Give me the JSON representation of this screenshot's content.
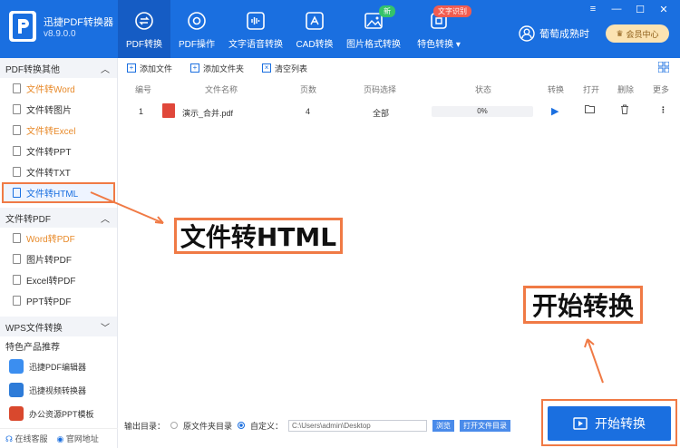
{
  "app": {
    "name": "迅捷PDF转换器",
    "version": "v8.9.0.0"
  },
  "nav": [
    {
      "label": "PDF转换",
      "icon": "swap-icon",
      "active": true
    },
    {
      "label": "PDF操作",
      "icon": "target-icon"
    },
    {
      "label": "文字语音转换",
      "icon": "audio-wave-icon"
    },
    {
      "label": "CAD转换",
      "icon": "cad-icon"
    },
    {
      "label": "图片格式转换",
      "icon": "image-icon",
      "badge": "新"
    },
    {
      "label": "特色转换",
      "icon": "feature-icon",
      "badge": "文字识别"
    }
  ],
  "user": {
    "name": "葡萄成熟时",
    "vip_label": "会员中心"
  },
  "sidebar": {
    "sections": [
      {
        "title": "PDF转换其他",
        "items": [
          "文件转Word",
          "文件转图片",
          "文件转Excel",
          "文件转PPT",
          "文件转TXT",
          "文件转HTML"
        ]
      },
      {
        "title": "文件转PDF",
        "items": [
          "Word转PDF",
          "图片转PDF",
          "Excel转PDF",
          "PPT转PDF"
        ]
      }
    ],
    "wps_title": "WPS文件转换",
    "products_title": "特色产品推荐",
    "products": [
      "迅捷PDF编辑器",
      "迅捷视频转换器",
      "办公资源PPT模板"
    ],
    "bottom": {
      "service": "在线客服",
      "website": "官网地址"
    }
  },
  "toolbar": {
    "add_file": "添加文件",
    "add_folder": "添加文件夹",
    "clear": "清空列表"
  },
  "table": {
    "headers": [
      "编号",
      "文件名称",
      "页数",
      "页码选择",
      "状态",
      "转换",
      "打开",
      "删除",
      "更多"
    ],
    "rows": [
      {
        "index": "1",
        "name": "演示_合并.pdf",
        "pages": "4",
        "range": "全部",
        "progress": "0%"
      }
    ]
  },
  "output": {
    "label": "输出目录：",
    "option_source": "原文件夹目录",
    "option_custom": "自定义：",
    "path": "C:\\Users\\admin\\Desktop",
    "browse": "浏览",
    "open_folder": "打开文件目录"
  },
  "start_button": "开始转换",
  "annotations": {
    "html_callout": "文件转HTML",
    "start_callout": "开始转换"
  },
  "colors": {
    "primary": "#1a6fe0",
    "accent": "#f07a45"
  }
}
